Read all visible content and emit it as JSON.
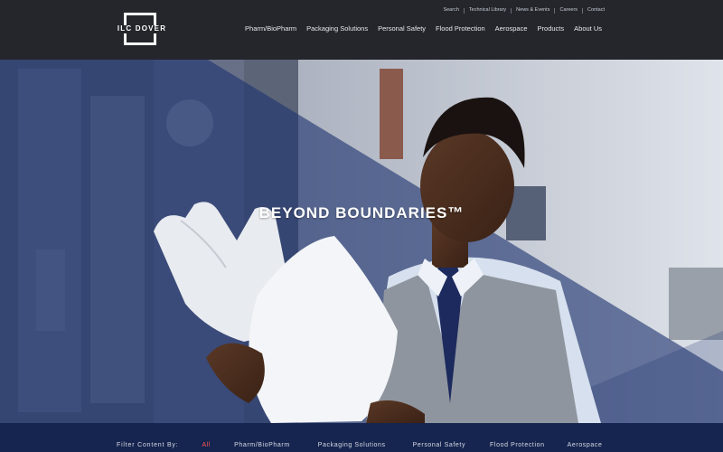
{
  "brand": {
    "logo_text": "ILC DOVER"
  },
  "utility_nav": [
    "Search",
    "Technical Library",
    "News & Events",
    "Careers",
    "Contact"
  ],
  "main_nav": [
    "Pharm/BioPharm",
    "Packaging Solutions",
    "Personal Safety",
    "Flood Protection",
    "Aerospace",
    "Products",
    "About Us"
  ],
  "hero": {
    "headline": "BEYOND BOUNDARIES™"
  },
  "filter": {
    "label": "Filter Content By:",
    "options": [
      "All",
      "Pharm/BioPharm",
      "Packaging Solutions",
      "Personal Safety",
      "Flood Protection",
      "Aerospace"
    ],
    "active": "All"
  },
  "colors": {
    "header_bg": "#24262c",
    "overlay_navy": "#1e3470",
    "filter_bg": "#16254f",
    "active_filter": "#ff5a4e"
  }
}
